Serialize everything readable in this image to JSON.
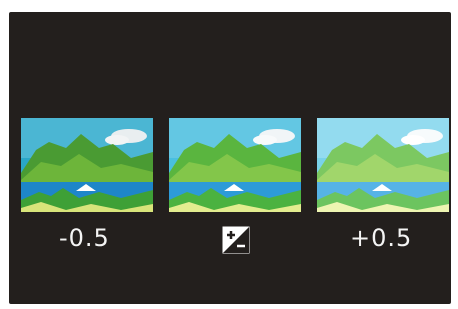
{
  "exposure_preview": {
    "thumbnails": [
      {
        "id": "minus",
        "label": "-0.5"
      },
      {
        "id": "zero",
        "label": ""
      },
      {
        "id": "plus",
        "label": "+0.5"
      }
    ],
    "center_icon": "exposure-compensation-icon"
  },
  "colors": {
    "panel": "#231f1d",
    "text": "#f4f4f4"
  }
}
